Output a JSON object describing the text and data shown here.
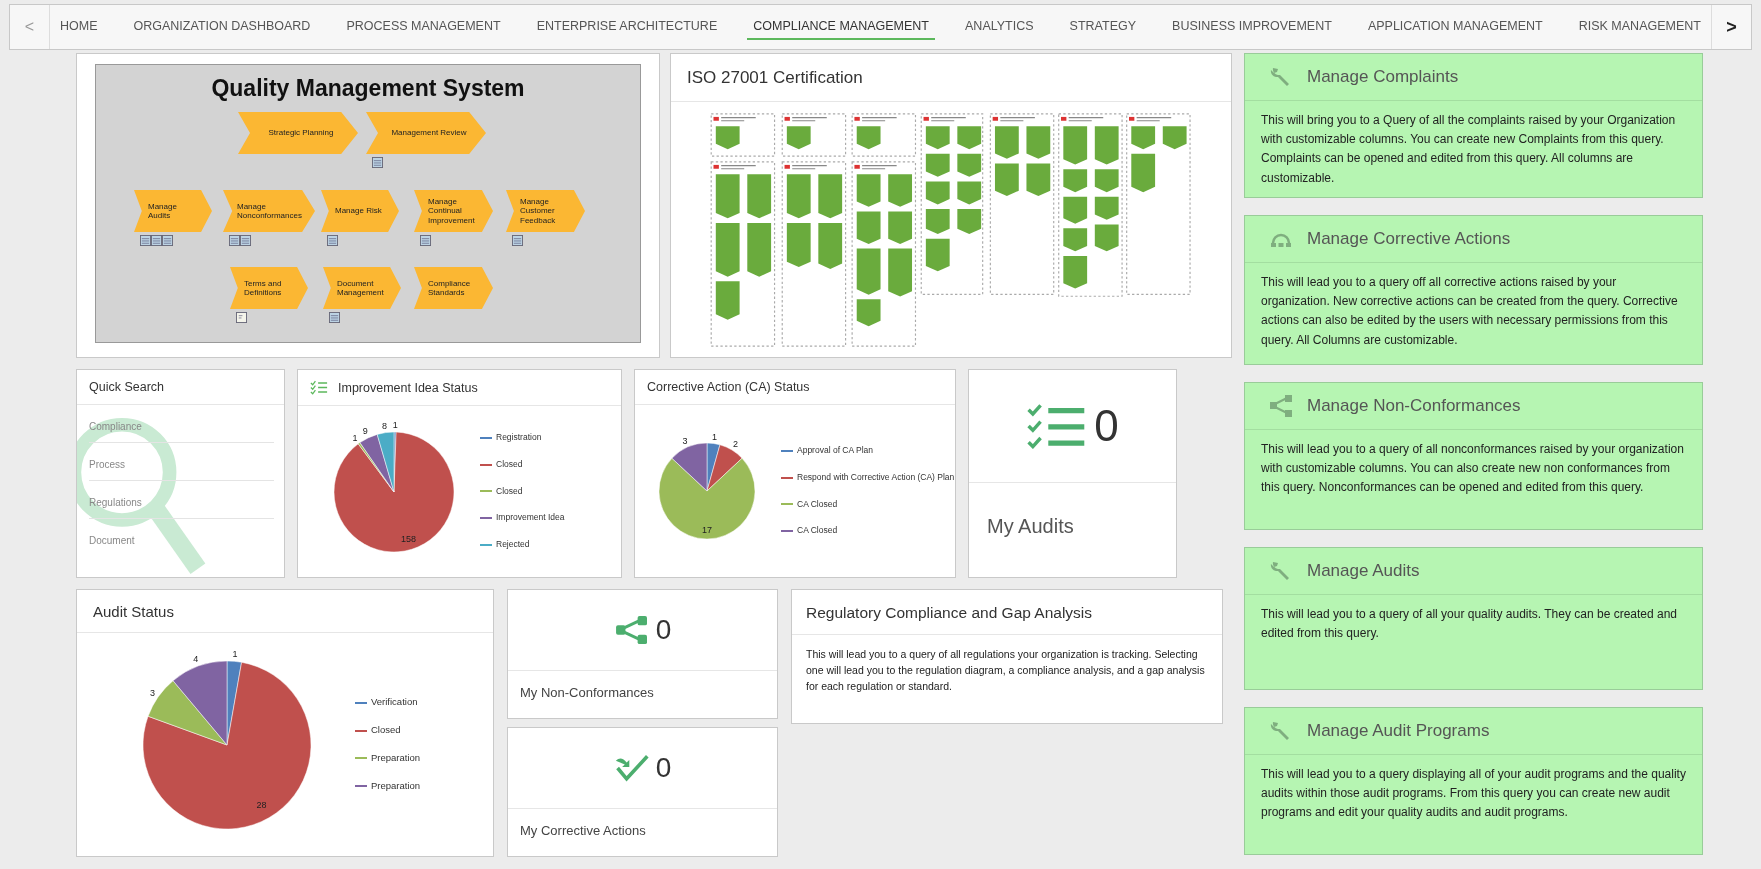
{
  "nav": {
    "prev": "<",
    "next": ">",
    "tabs": [
      {
        "label": "HOME",
        "selected": false
      },
      {
        "label": "ORGANIZATION DASHBOARD",
        "selected": false
      },
      {
        "label": "PROCESS MANAGEMENT",
        "selected": false
      },
      {
        "label": "ENTERPRISE ARCHITECTURE",
        "selected": false
      },
      {
        "label": "COMPLIANCE MANAGEMENT",
        "selected": true
      },
      {
        "label": "ANALYTICS",
        "selected": false
      },
      {
        "label": "STRATEGY",
        "selected": false
      },
      {
        "label": "BUSINESS IMPROVEMENT",
        "selected": false
      },
      {
        "label": "APPLICATION MANAGEMENT",
        "selected": false
      },
      {
        "label": "RISK MANAGEMENT",
        "selected": false
      }
    ]
  },
  "qms": {
    "title": "Quality Management System",
    "steps": [
      {
        "label": "Strategic Planning"
      },
      {
        "label": "Management Review",
        "attachments": [
          {
            "kind": "sheet"
          }
        ]
      },
      {
        "label": "Manage Audits",
        "attachments": [
          {
            "kind": "sheet"
          },
          {
            "kind": "sheet"
          },
          {
            "kind": "sheet"
          }
        ]
      },
      {
        "label": "Manage Nonconformances",
        "attachments": [
          {
            "kind": "sheet"
          },
          {
            "kind": "sheet"
          }
        ]
      },
      {
        "label": "Manage Risk",
        "attachments": [
          {
            "kind": "sheet"
          }
        ]
      },
      {
        "label": "Manage Continual Improvement",
        "attachments": [
          {
            "kind": "sheet"
          }
        ]
      },
      {
        "label": "Manage Customer Feedback",
        "attachments": [
          {
            "kind": "sheet"
          }
        ]
      },
      {
        "label": "Terms and Definitions",
        "attachments": [
          {
            "kind": "note"
          }
        ]
      },
      {
        "label": "Document Management",
        "attachments": [
          {
            "kind": "sheet"
          }
        ]
      },
      {
        "label": "Compliance Standards"
      }
    ]
  },
  "iso": {
    "title": "ISO 27001 Certification"
  },
  "quick_search": {
    "title": "Quick Search",
    "items": [
      "Compliance",
      "Process",
      "Regulations",
      "Document"
    ]
  },
  "improvement": {
    "title": "Improvement Idea Status",
    "chart_data": {
      "type": "pie",
      "categories": [
        "Registration",
        "Closed",
        "Closed",
        "Improvement Idea",
        "Rejected"
      ],
      "values": [
        1,
        158,
        1,
        9,
        8
      ],
      "data_labels": true,
      "legend": "right"
    }
  },
  "ca_status": {
    "title": "Corrective Action (CA) Status",
    "chart_data": {
      "type": "pie",
      "categories": [
        "Approval of CA Plan",
        "Respond with Corrective Action (CA) Plan",
        "CA Closed",
        "CA Closed"
      ],
      "values": [
        1,
        2,
        17,
        3
      ],
      "data_labels": true,
      "legend": "right"
    }
  },
  "my_audits": {
    "count": "0",
    "label": "My Audits"
  },
  "audit_status": {
    "title": "Audit Status",
    "chart_data": {
      "type": "pie",
      "categories": [
        "Verification",
        "Closed",
        "Preparation",
        "Preparation"
      ],
      "values": [
        1,
        28,
        3,
        4
      ],
      "data_labels": true,
      "legend": "right"
    }
  },
  "my_nonconformances": {
    "count": "0",
    "label": "My Non-Conformances"
  },
  "my_corrective_actions": {
    "count": "0",
    "label": "My Corrective Actions"
  },
  "regulatory": {
    "title": "Regulatory Compliance and Gap Analysis",
    "text": "This will lead you to a query of all regulations your organization is tracking. Selecting one will lead you to the regulation diagram, a compliance analysis, and a gap analysis for each regulation or standard."
  },
  "actions": [
    {
      "kind": "wrench",
      "title": "Manage Complaints",
      "text": "This will bring you to a Query of all the complaints raised by your Organization with customizable columns. You can create new Complaints from this query. Complaints can be opened and edited from this query. All columns are customizable."
    },
    {
      "kind": "headset",
      "title": "Manage Corrective Actions",
      "text": "This will lead you to a query off all corrective actions raised by your organization. New corrective actions can be created from the query. Corrective actions can also be edited by the users with necessary permissions from this query. All Columns are customizable."
    },
    {
      "kind": "share",
      "title": "Manage Non-Conformances",
      "text": "This will lead you to a query of all nonconformances raised by your organization with customizable columns. You can also create new non conformances from this query. Nonconformances can be opened and edited from this query."
    },
    {
      "kind": "wrench",
      "title": "Manage Audits",
      "text": "This will lead you to a query of all your quality audits. They can be created and edited from this query."
    },
    {
      "kind": "wrench",
      "title": "Manage Audit Programs",
      "text": "This will lead you to a query displaying all of your audit programs and the quality audits within those audit programs. From this query you can create new audit programs and edit your quality audits and audit programs."
    }
  ]
}
